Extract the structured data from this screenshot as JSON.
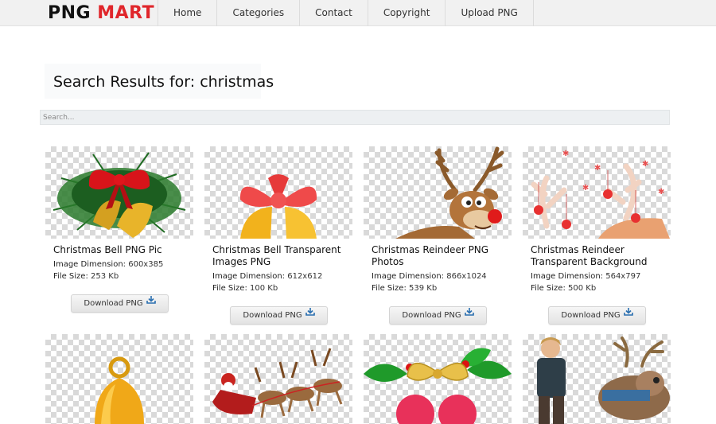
{
  "site": {
    "logo_part1": "PNG",
    "logo_part2": "MART",
    "logo_color_dark": "#111111",
    "logo_color_red": "#e0262b"
  },
  "nav": {
    "items": [
      {
        "label": "Home"
      },
      {
        "label": "Categories"
      },
      {
        "label": "Contact"
      },
      {
        "label": "Copyright"
      },
      {
        "label": "Upload PNG"
      }
    ]
  },
  "heading": "Search Results for: christmas",
  "search": {
    "placeholder": "Search...",
    "value": ""
  },
  "labels": {
    "dimension": "Image Dimension:",
    "filesize": "File Size:",
    "download": "Download PNG",
    "download_icon": "download-tray-icon"
  },
  "results": [
    {
      "title": "Christmas Bell PNG Pic",
      "dimension": "600x385",
      "filesize": "253 Kb",
      "icon": "christmas-bell-bow-image"
    },
    {
      "title": "Christmas Bell Transparent Images PNG",
      "dimension": "612x612",
      "filesize": "100 Kb",
      "icon": "red-bow-bell-image"
    },
    {
      "title": "Christmas Reindeer PNG Photos",
      "dimension": "866x1024",
      "filesize": "539 Kb",
      "icon": "cartoon-reindeer-image"
    },
    {
      "title": "Christmas Reindeer Transparent Background",
      "dimension": "564x797",
      "filesize": "500 Kb",
      "icon": "reindeer-antlers-ornaments-image"
    },
    {
      "title": "",
      "dimension": "",
      "filesize": "",
      "icon": "golden-bell-image"
    },
    {
      "title": "",
      "dimension": "",
      "filesize": "",
      "icon": "santa-sleigh-reindeer-image"
    },
    {
      "title": "",
      "dimension": "",
      "filesize": "",
      "icon": "holly-bow-ornaments-image"
    },
    {
      "title": "",
      "dimension": "",
      "filesize": "",
      "icon": "kristoff-sven-image"
    }
  ]
}
